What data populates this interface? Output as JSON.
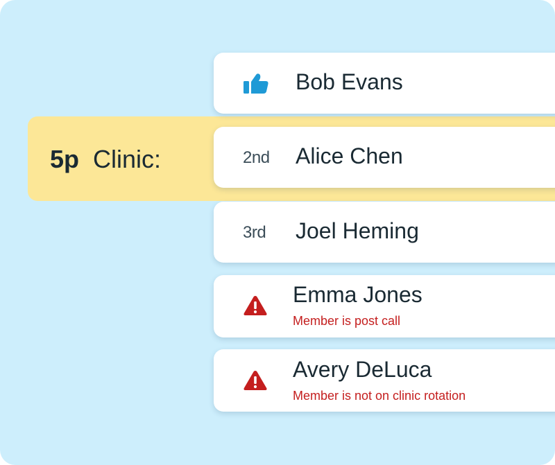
{
  "slot": {
    "time": "5p",
    "title": "Clinic:"
  },
  "cards": [
    {
      "name": "Bob Evans",
      "icon": "thumbs-up-icon"
    },
    {
      "name": "Alice Chen",
      "rank": "2nd"
    },
    {
      "name": "Joel Heming",
      "rank": "3rd"
    },
    {
      "name": "Emma Jones",
      "icon": "warning-icon",
      "warning": "Member is post call"
    },
    {
      "name": "Avery DeLuca",
      "icon": "warning-icon",
      "warning": "Member is not on clinic rotation"
    }
  ],
  "colors": {
    "background": "#cdeefc",
    "highlight": "#fce797",
    "accent_blue": "#1f9ad6",
    "warning_red": "#c41e1e",
    "text": "#1a2a33"
  }
}
